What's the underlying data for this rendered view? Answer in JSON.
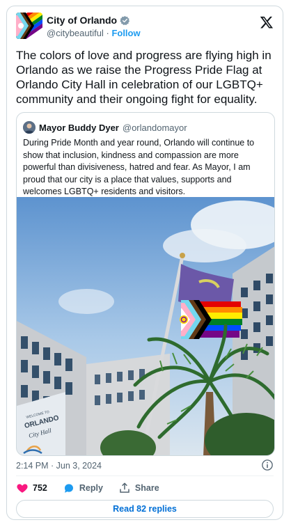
{
  "author": {
    "name": "City of Orlando",
    "handle": "@citybeautiful",
    "follow_label": "Follow"
  },
  "tweet": {
    "text": "The colors of love and progress are flying high in Orlando as we raise the Progress Pride Flag at Orlando City Hall in celebration of our LGBTQ+ community and their ongoing fight for equality.",
    "timestamp": "2:14 PM · Jun 3, 2024"
  },
  "quoted": {
    "name": "Mayor Buddy Dyer",
    "handle": "@orlandomayor",
    "text": "During Pride Month and year round, Orlando will continue to show that inclusion, kindness and compassion are more powerful than divisiveness, hatred and fear. As Mayor, I am proud that our city is a place that values, supports and welcomes LGBTQ+ residents and visitors.",
    "image_sign": {
      "line1": "WELCOME TO",
      "line2": "ORLANDO",
      "line3": "City Hall"
    }
  },
  "actions": {
    "likes_count": "752",
    "reply_label": "Reply",
    "share_label": "Share",
    "read_replies_label": "Read 82 replies"
  },
  "colors": {
    "accent": "#1d9bf0",
    "heart": "#f91880",
    "text": "#0f1419",
    "muted": "#536471"
  },
  "icons": [
    "x-logo-icon",
    "verified-badge-icon",
    "info-icon",
    "heart-icon",
    "reply-icon",
    "share-icon"
  ]
}
